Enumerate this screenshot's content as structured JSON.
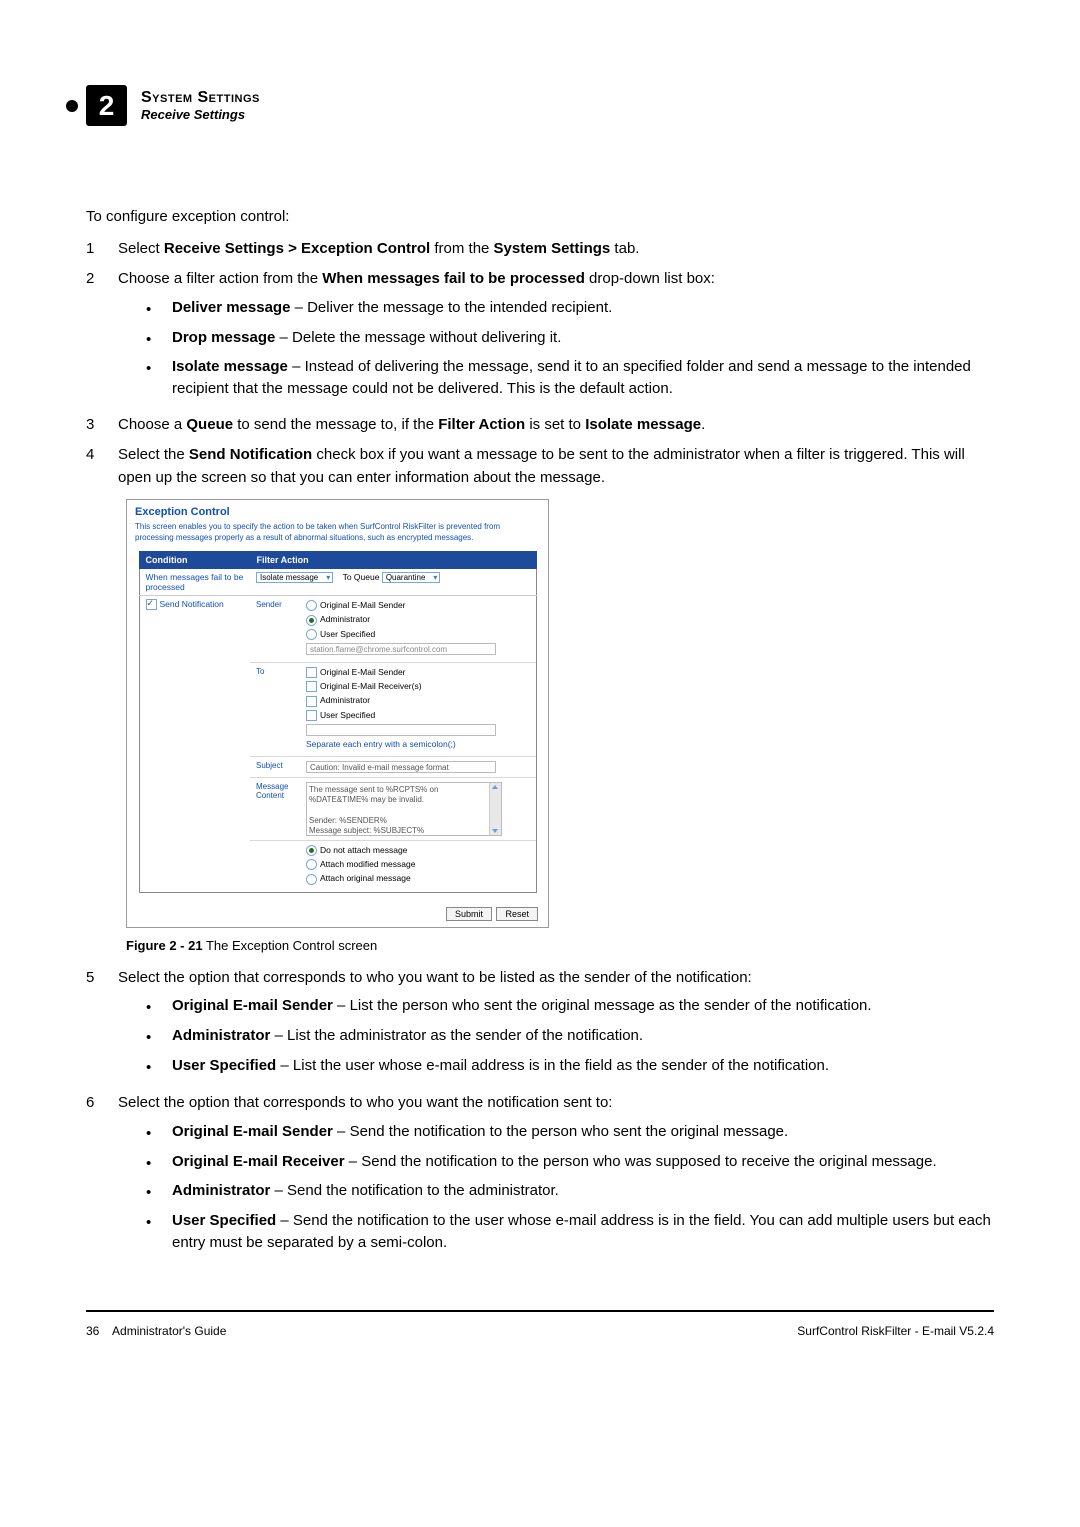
{
  "header": {
    "chapter_num": "2",
    "title": "System Settings",
    "subtitle": "Receive Settings"
  },
  "intro": "To configure exception control:",
  "steps": {
    "s1_a": "Select ",
    "s1_b": "Receive Settings > Exception Control",
    "s1_c": " from the ",
    "s1_d": "System Settings",
    "s1_e": " tab.",
    "s2_a": "Choose a filter action from the ",
    "s2_b": "When messages fail to be processed",
    "s2_c": " drop-down list box:",
    "s2_bullets": [
      {
        "b": "Deliver message",
        "rest": " – Deliver the message to the intended recipient."
      },
      {
        "b": "Drop message",
        "rest": " – Delete the message without delivering it."
      },
      {
        "b": "Isolate message",
        "rest": " – Instead of delivering the message, send it to an specified folder and send a message to the intended recipient that the message could not be delivered. This is the default action."
      }
    ],
    "s3_a": "Choose a ",
    "s3_b": "Queue",
    "s3_c": " to send the message to, if the ",
    "s3_d": "Filter Action",
    "s3_e": " is set to ",
    "s3_f": "Isolate message",
    "s3_g": ".",
    "s4_a": "Select the ",
    "s4_b": "Send Notification",
    "s4_c": " check box if you want a message to be sent to the administrator when a filter is triggered. This will open up the screen so that you can enter information about the message.",
    "s5": "Select the option that corresponds to who you want to be listed as the sender of the notification:",
    "s5_bullets": [
      {
        "b": "Original E-mail Sender",
        "rest": " – List the person who sent the original message as the sender of the notification."
      },
      {
        "b": "Administrator",
        "rest": " – List the administrator as the sender of the notification."
      },
      {
        "b": "User Specified",
        "rest": " – List the user whose e-mail address is in the field as the sender of the notification."
      }
    ],
    "s6": "Select the option that corresponds to who you want the notification sent to:",
    "s6_bullets": [
      {
        "b": "Original E-mail Sender",
        "rest": " – Send the notification to the person who sent the original message."
      },
      {
        "b": "Original E-mail Receiver",
        "rest": " – Send the notification to the person who was supposed to receive the original message."
      },
      {
        "b": "Administrator",
        "rest": " – Send the notification to the administrator."
      },
      {
        "b": "User Specified",
        "rest": " – Send the notification to the user whose e-mail address is in the field. You can add multiple users but each entry must be separated by a semi-colon."
      }
    ]
  },
  "figure": {
    "caption_bold": "Figure 2 - 21",
    "caption_rest": " The Exception Control screen",
    "panel_title": "Exception Control",
    "panel_desc": "This screen enables you to specify the action to be taken when SurfControl RiskFilter is prevented from processing messages properly as a result of abnormal situations, such as encrypted messages.",
    "th_condition": "Condition",
    "th_action": "Filter Action",
    "row1_label": "When messages fail to be processed",
    "sel_isolate": "Isolate message",
    "to_queue_label": "To Queue",
    "sel_quarantine": "Quarantine",
    "row2_label": "Send Notification",
    "sender_label": "Sender",
    "sender_opt1": "Original E-Mail Sender",
    "sender_opt2": "Administrator",
    "sender_opt3": "User Specified",
    "sender_field": "station.flame@chrome.surfcontrol.com",
    "to_label": "To",
    "to_opt1": "Original E-Mail Sender",
    "to_opt2": "Original E-Mail Receiver(s)",
    "to_opt3": "Administrator",
    "to_opt4": "User Specified",
    "to_hint": "Separate each entry with a semicolon(;)",
    "subject_label": "Subject",
    "subject_value": "Caution: Invalid e-mail message format",
    "content_label": "Message Content",
    "content_text": "The message sent to %RCPTS% on %DATE&TIME% may be invalid.\n\nSender: %SENDER%\nMessage subject: %SUBJECT%",
    "attach_opt1": "Do not attach message",
    "attach_opt2": "Attach modified message",
    "attach_opt3": "Attach original message",
    "btn_submit": "Submit",
    "btn_reset": "Reset"
  },
  "footer": {
    "page_num": "36",
    "guide": "Administrator's Guide",
    "product": "SurfControl RiskFilter - E-mail V5.2.4"
  }
}
